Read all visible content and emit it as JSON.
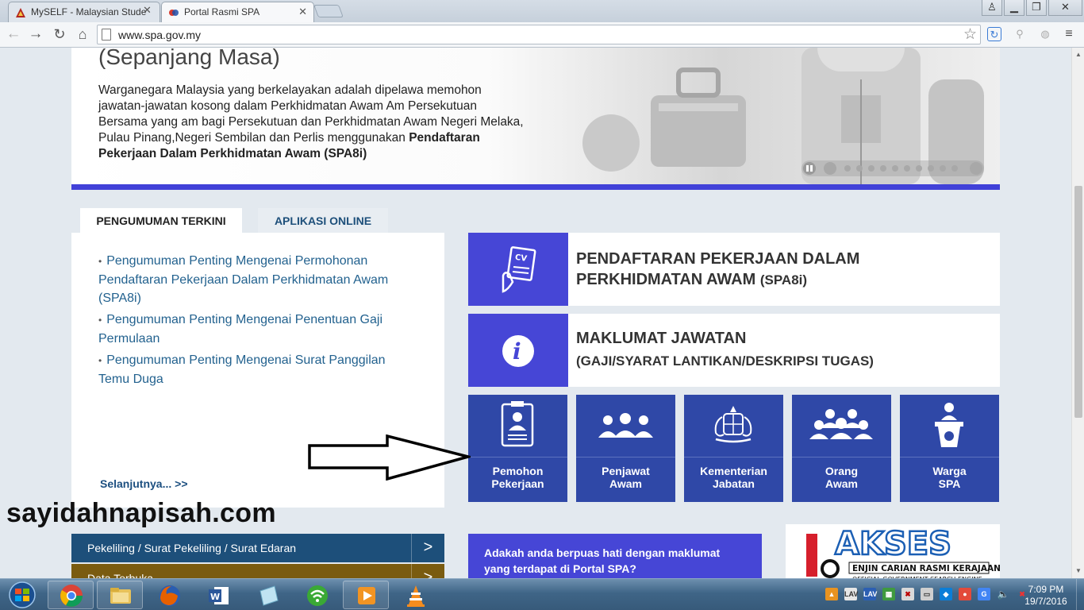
{
  "browser": {
    "tabs": [
      {
        "title": "MySELF - Malaysian Stude",
        "active": false
      },
      {
        "title": "Portal Rasmi SPA",
        "active": true
      }
    ],
    "url": "www.spa.gov.my"
  },
  "banner": {
    "heading": "(Sepanjang Masa)",
    "body": "Warganegara Malaysia yang berkelayakan adalah dipelawa memohon jawatan-jawatan kosong dalam Perkhidmatan Awam Am Persekutuan Bersama yang am bagi Persekutuan dan Perkhidmatan Awam Negeri Melaka, Pulau Pinang,Negeri Sembilan dan Perlis menggunakan",
    "body_bold": "Pendaftaran Pekerjaan Dalam Perkhidmatan Awam (SPA8i)"
  },
  "panel_tabs": [
    "PENGUMUMAN TERKINI",
    "APLIKASI ONLINE"
  ],
  "announcements": [
    "Pengumuman Penting Mengenai Permohonan Pendaftaran Pekerjaan Dalam Perkhidmatan Awam (SPA8i)",
    "Pengumuman Penting Mengenai Penentuan Gaji Permulaan",
    "Pengumuman Penting Mengenai Surat Panggilan Temu Duga"
  ],
  "more_link": "Selanjutnya... >>",
  "spa8i": {
    "line1": "PENDAFTARAN PEKERJAAN DALAM",
    "line2": "PERKHIDMATAN AWAM",
    "suffix": "(SPA8i)"
  },
  "maklumat": {
    "title": "MAKLUMAT JAWATAN",
    "subtitle": "(GAJI/SYARAT LANTIKAN/DESKRIPSI TUGAS)"
  },
  "tiles": [
    {
      "line1": "Pemohon",
      "line2": "Pekerjaan",
      "icon": "applicant-icon"
    },
    {
      "line1": "Penjawat",
      "line2": "Awam",
      "icon": "civil-servant-icon"
    },
    {
      "line1": "Kementerian",
      "line2": "Jabatan",
      "icon": "coat-of-arms-icon"
    },
    {
      "line1": "Orang",
      "line2": "Awam",
      "icon": "public-icon"
    },
    {
      "line1": "Warga",
      "line2": "SPA",
      "icon": "spa-staff-icon"
    }
  ],
  "watermark": "sayidahnapisah.com",
  "link_bars": [
    {
      "label": "Pekeliling / Surat Pekeliling / Surat Edaran",
      "color": "#1d4f7a"
    },
    {
      "label": "Data Terbuka",
      "color": "#7a5b10"
    }
  ],
  "chevron": ">",
  "survey": "Adakah anda berpuas hati dengan maklumat yang terdapat di Portal SPA?",
  "akses": {
    "title": "AKSES",
    "subtitle": "ENJIN CARIAN RASMI KERAJAAN",
    "caption": "OFFICIAL GOVERNMENT SEARCH ENGINE"
  },
  "clock": {
    "time": "7:09 PM",
    "date": "19/7/2016"
  },
  "colors": {
    "accent": "#4646d6",
    "tile": "#2f48a7",
    "link": "#23628f"
  }
}
